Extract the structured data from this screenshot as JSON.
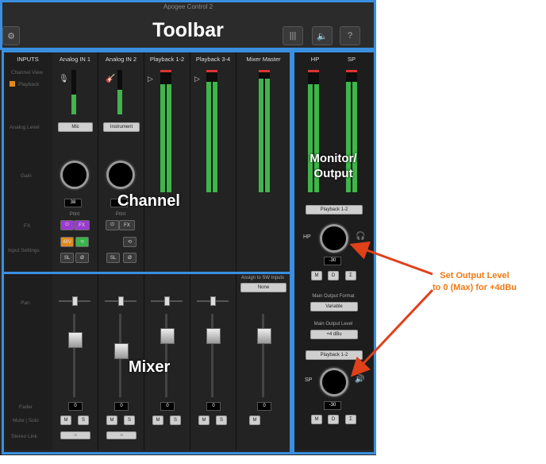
{
  "toolbar": {
    "app_name": "Apogee Control 2",
    "label": "Toolbar"
  },
  "headers": [
    "INPUTS",
    "Analog IN 1",
    "Analog IN 2",
    "Playback 1-2",
    "Playback 3-4",
    "Mixer Master"
  ],
  "out_headers": [
    "HP",
    "SP"
  ],
  "row_labels": {
    "channel_view": "Channel View",
    "playback": "Playback",
    "analog_level": "Analog Level",
    "gain": "Gain",
    "fx": "FX",
    "input_settings": "Input Settings",
    "pan": "Pan",
    "fader": "Fader",
    "mute_solo": "Mute | Solo",
    "stereo_link": "Stereo Link"
  },
  "analog_level": {
    "in1": "Mic",
    "in2": "Instrument"
  },
  "gain_values": {
    "in1": "38",
    "in2": "0"
  },
  "print_label": "Print",
  "fx_label": "FX",
  "phantom_label": "48V",
  "sl_label": "SL",
  "phase_label": "Ø",
  "overlays": {
    "channel": "Channel",
    "mixer": "Mixer",
    "monitor": "Monitor/\nOutput"
  },
  "mixer": {
    "assign_label": "Assign to SW Inputs",
    "assign_value": "None",
    "fader_values": [
      "0",
      "0",
      "0",
      "0",
      "0"
    ],
    "m": "M",
    "s": "S"
  },
  "output": {
    "hp_source": "Playback 1-2",
    "hp_label": "HP",
    "hp_value": "-30",
    "buttons": [
      "M",
      "D",
      "Σ"
    ],
    "format_label": "Main Output Format",
    "format_value": "Variable",
    "level_label": "Main Output Level",
    "level_value": "+4 dBu",
    "sp_source": "Playback 1-2",
    "sp_label": "SP",
    "sp_value": "-30"
  },
  "annotation": "Set Output Level\nto 0 (Max) for +4dBu",
  "meters": {
    "in1": 0.45,
    "in2": 0.55,
    "pb12": 0.88,
    "pb34": 0.9,
    "master": 0.93,
    "hp": 0.88,
    "sp": 0.9
  }
}
